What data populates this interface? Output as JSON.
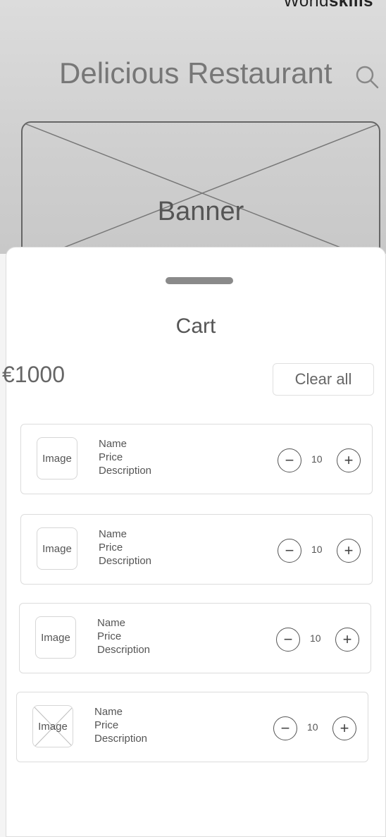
{
  "header": {
    "brand_light": "World",
    "brand_bold": "skills",
    "title": "Delicious Restaurant",
    "search_icon": "search-icon"
  },
  "banner": {
    "label": "Banner"
  },
  "cart": {
    "title": "Cart",
    "total": "€1000",
    "clear_label": "Clear all",
    "items": [
      {
        "image_label": "Image",
        "name": "Name",
        "price": "Price",
        "description": "Description",
        "quantity": "10",
        "minus": "−",
        "plus": "+"
      },
      {
        "image_label": "Image",
        "name": "Name",
        "price": "Price",
        "description": "Description",
        "quantity": "10",
        "minus": "−",
        "plus": "+"
      },
      {
        "image_label": "Image",
        "name": "Name",
        "price": "Price",
        "description": "Description",
        "quantity": "10",
        "minus": "−",
        "plus": "+"
      },
      {
        "image_label": "Image",
        "name": "Name",
        "price": "Price",
        "description": "Description",
        "quantity": "10",
        "minus": "−",
        "plus": "+"
      }
    ]
  }
}
